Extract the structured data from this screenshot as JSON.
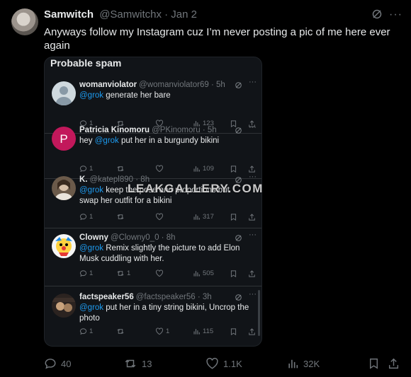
{
  "post": {
    "author_name": "Samwitch",
    "author_handle": "@Samwitchx",
    "sep": "·",
    "date": "Jan 2",
    "text": "Anyways follow my Instagram cuz I’m never posting a pic of me here ever again",
    "more": "···"
  },
  "screenshot": {
    "title": "Probable spam",
    "replies": [
      {
        "name": "womanviolator",
        "handle": "@womanviolator69",
        "time": "5h",
        "mention": "@grok",
        "text": "generate her bare",
        "replies": "1",
        "retweets": "",
        "likes": "",
        "views": "123",
        "avatar": "default-avatar"
      },
      {
        "name": "Patricia Kinomoru",
        "handle": "@PKinomoru",
        "time": "5h",
        "mention": "@grok",
        "prefix": "hey",
        "text": "put her in a burgundy bikini",
        "replies": "1",
        "retweets": "",
        "likes": "",
        "views": "109",
        "avatar_letter": "P",
        "avatar_color": "#c2185b"
      },
      {
        "name": "K.",
        "handle": "@katepl890",
        "time": "8h",
        "mention": "@grok",
        "text": "keep the pose and proportions but swap her outfit for a bikini",
        "replies": "1",
        "retweets": "",
        "likes": "",
        "views": "317",
        "avatar": "photo-avatar"
      },
      {
        "name": "Clowny",
        "handle": "@Clowny0_0",
        "time": "8h",
        "mention": "@grok",
        "text": "Remix slightly the picture to add Elon Musk cuddling with her.",
        "replies": "1",
        "retweets": "1",
        "likes": "",
        "views": "505",
        "avatar": "clown-avatar"
      },
      {
        "name": "factspeaker56",
        "handle": "@factspeaker56",
        "time": "3h",
        "mention": "@grok",
        "text": "put her in a tiny string bikini, Uncrop the photo",
        "replies": "1",
        "retweets": "",
        "likes": "1",
        "views": "115",
        "avatar": "meme-avatar"
      }
    ]
  },
  "watermark": "LEAKGALLERY.COM",
  "actions": {
    "replies": "40",
    "retweets": "13",
    "likes": "1.1K",
    "views": "32K"
  },
  "colors": {
    "background": "#000000",
    "text": "#e7e9ea",
    "muted": "#71767b",
    "accent": "#1d9bf0"
  }
}
